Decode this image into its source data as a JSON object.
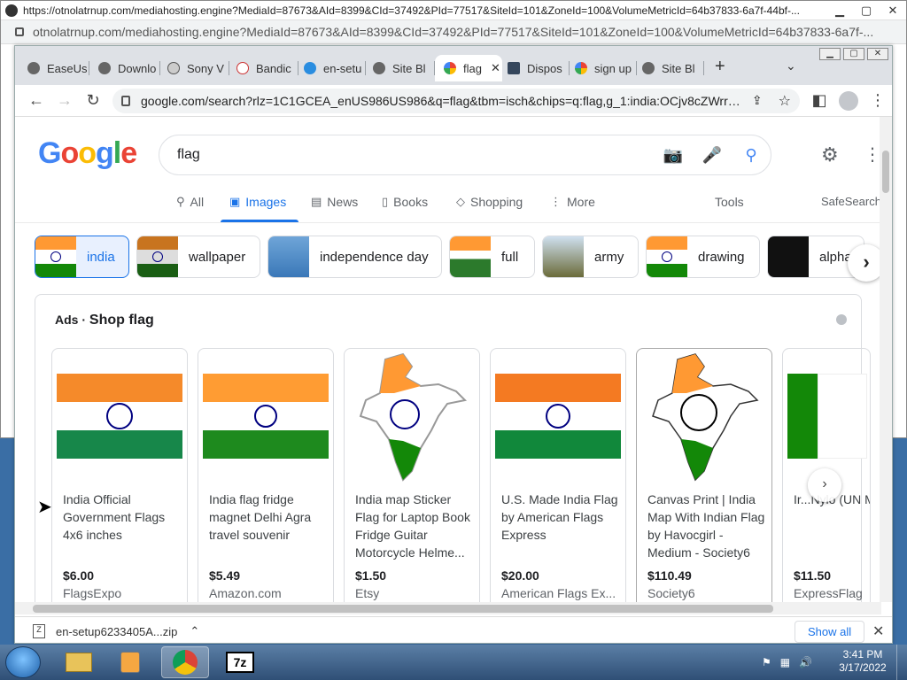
{
  "outer_window": {
    "title": "https://otnolatrnup.com/mediahosting.engine?MediaId=87673&AId=8399&CId=37492&PId=77517&SiteId=101&ZoneId=100&VolumeMetricId=64b37833-6a7f-44bf-...",
    "address": "otnolatrnup.com/mediahosting.engine?MediaId=87673&AId=8399&CId=37492&PId=77517&SiteId=101&ZoneId=100&VolumeMetricId=64b37833-6a7f-..."
  },
  "tabs": [
    {
      "label": "EaseUs"
    },
    {
      "label": "Downlo"
    },
    {
      "label": "Sony V"
    },
    {
      "label": "Bandic"
    },
    {
      "label": "en-setu"
    },
    {
      "label": "Site Bl"
    },
    {
      "label": "flag"
    },
    {
      "label": "Dispos"
    },
    {
      "label": "sign up"
    },
    {
      "label": "Site Bl"
    }
  ],
  "omnibox": {
    "url": "google.com/search?rlz=1C1GCEA_enUS986US986&q=flag&tbm=isch&chips=q:flag,g_1:india:OCjv8cZWrrc..."
  },
  "google": {
    "logo": "Google",
    "query": "flag",
    "nav": {
      "all": "All",
      "images": "Images",
      "news": "News",
      "books": "Books",
      "shopping": "Shopping",
      "more": "More",
      "tools": "Tools",
      "safesearch": "SafeSearch"
    },
    "chips": [
      {
        "label": "india"
      },
      {
        "label": "wallpaper"
      },
      {
        "label": "independence day"
      },
      {
        "label": "full"
      },
      {
        "label": "army"
      },
      {
        "label": "drawing"
      },
      {
        "label": "alpha"
      }
    ],
    "ads": {
      "prefix": "Ads ·",
      "title": "Shop flag",
      "products": [
        {
          "title": "India Official Government Flags 4x6 inches",
          "price": "$6.00",
          "store": "FlagsExpo"
        },
        {
          "title": "India flag fridge magnet Delhi Agra travel souvenir",
          "price": "$5.49",
          "store": "Amazon.com"
        },
        {
          "title": "India map Sticker Flag for Laptop Book Fridge Guitar Motorcycle Helme...",
          "price": "$1.50",
          "store": "Etsy"
        },
        {
          "title": "U.S. Made India Flag by American Flags Express",
          "price": "$20.00",
          "store": "American Flags Ex..."
        },
        {
          "title": "Canvas Print | India Map With Indian Flag by Havocgirl - Medium - Society6",
          "price": "$110.49",
          "store": "Society6"
        },
        {
          "title": "Ir...Nylo (UN Membe",
          "price": "$11.50",
          "store": "ExpressFlag"
        }
      ]
    }
  },
  "downloads": {
    "file": "en-setup6233405A...zip",
    "show_all": "Show all"
  },
  "taskbar": {
    "time": "3:41 PM",
    "date": "3/17/2022"
  },
  "colors": {
    "google_blue": "#4285f4",
    "saffron": "#ff9933",
    "india_green": "#138808",
    "link_blue": "#1a73e8"
  }
}
